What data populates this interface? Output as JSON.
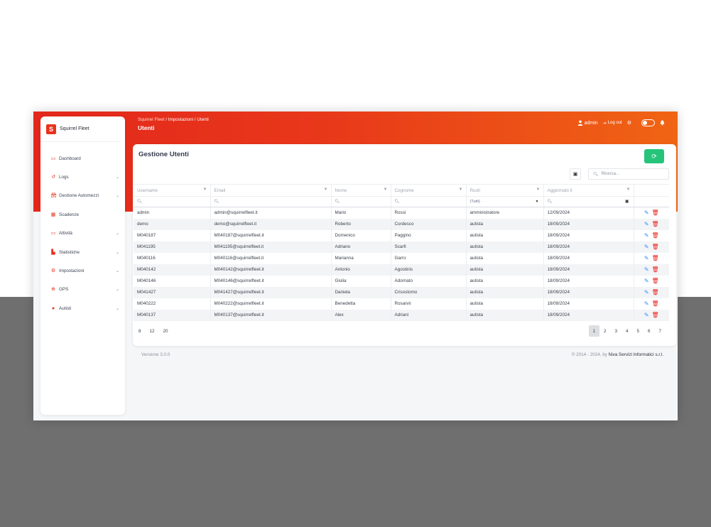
{
  "brand": {
    "name": "Squirrel Fleet",
    "logo_icon": "squirrel-logo"
  },
  "sidebar": {
    "items": [
      {
        "label": "Dashboard",
        "icon": "dashboard-icon",
        "expandable": false
      },
      {
        "label": "Logs",
        "icon": "history-icon",
        "expandable": true
      },
      {
        "label": "Gestione Automezzi",
        "icon": "car-icon",
        "expandable": true
      },
      {
        "label": "Scadenze",
        "icon": "calendar-icon",
        "expandable": false
      },
      {
        "label": "Attività",
        "icon": "laptop-icon",
        "expandable": true
      },
      {
        "label": "Statistiche",
        "icon": "chart-icon",
        "expandable": true
      },
      {
        "label": "Impostazioni",
        "icon": "gear-icon",
        "expandable": true
      },
      {
        "label": "GPS",
        "icon": "globe-icon",
        "expandable": true
      },
      {
        "label": "Autisti",
        "icon": "user-icon",
        "expandable": true
      }
    ]
  },
  "header": {
    "breadcrumb": {
      "root": "Squirrel Fleet",
      "sep": " / ",
      "path": "Impostazioni / Utenti"
    },
    "title": "Utenti",
    "user": "admin",
    "logout": "Log out"
  },
  "card": {
    "title": "Gestione Utenti",
    "search_placeholder": "Ricerca..."
  },
  "table": {
    "columns": [
      "Username",
      "Email",
      "Nome",
      "Cognome",
      "Ruoli",
      "Aggiornato il"
    ],
    "role_filter": "(Tutti)",
    "rows": [
      [
        "admin",
        "admin@squirrelfleet.it",
        "Mario",
        "Rossi",
        "amministratore",
        "12/09/2024"
      ],
      [
        "demo",
        "demo@squirrelfleet.it",
        "Roberto",
        "Cordesco",
        "autista",
        "18/09/2024"
      ],
      [
        "M040187",
        "M040187@squirrelfleet.it",
        "Domenico",
        "Paggino",
        "autista",
        "18/09/2024"
      ],
      [
        "M041195",
        "M041195@squirrelfleet.it",
        "Adriano",
        "Scarfi",
        "autista",
        "18/09/2024"
      ],
      [
        "M040116",
        "M040116@squirrelfleet.it",
        "Marianna",
        "Garro",
        "autista",
        "18/09/2024"
      ],
      [
        "M040142",
        "M040142@squirrelfleet.it",
        "Antonio",
        "Agostinis",
        "autista",
        "18/09/2024"
      ],
      [
        "M040146",
        "M040146@squirrelfleet.it",
        "Giulia",
        "Adornato",
        "autista",
        "18/09/2024"
      ],
      [
        "M041427",
        "M041427@squirrelfleet.it",
        "Daniela",
        "Crisostomo",
        "autista",
        "18/09/2024"
      ],
      [
        "M040222",
        "M040222@squirrelfleet.it",
        "Benedetta",
        "Rosanni",
        "autista",
        "18/09/2024"
      ],
      [
        "M040137",
        "M040137@squirrelfleet.it",
        "Alex",
        "Adriani",
        "autista",
        "18/09/2024"
      ]
    ]
  },
  "pagination": {
    "page_sizes": [
      "8",
      "12",
      "20"
    ],
    "pages": [
      "1",
      "2",
      "3",
      "4",
      "5",
      "6",
      "7"
    ],
    "current": "1"
  },
  "footer": {
    "version": "Versione 3.0.0",
    "copyright": "© 2014 - 2024, by ",
    "company": "Niva Servizi Informatici s.r.l."
  },
  "colors": {
    "accent": "#e8321b",
    "header_end": "#f06414",
    "success": "#25c47a",
    "edit": "#2f8cff",
    "delete": "#e8211b"
  }
}
